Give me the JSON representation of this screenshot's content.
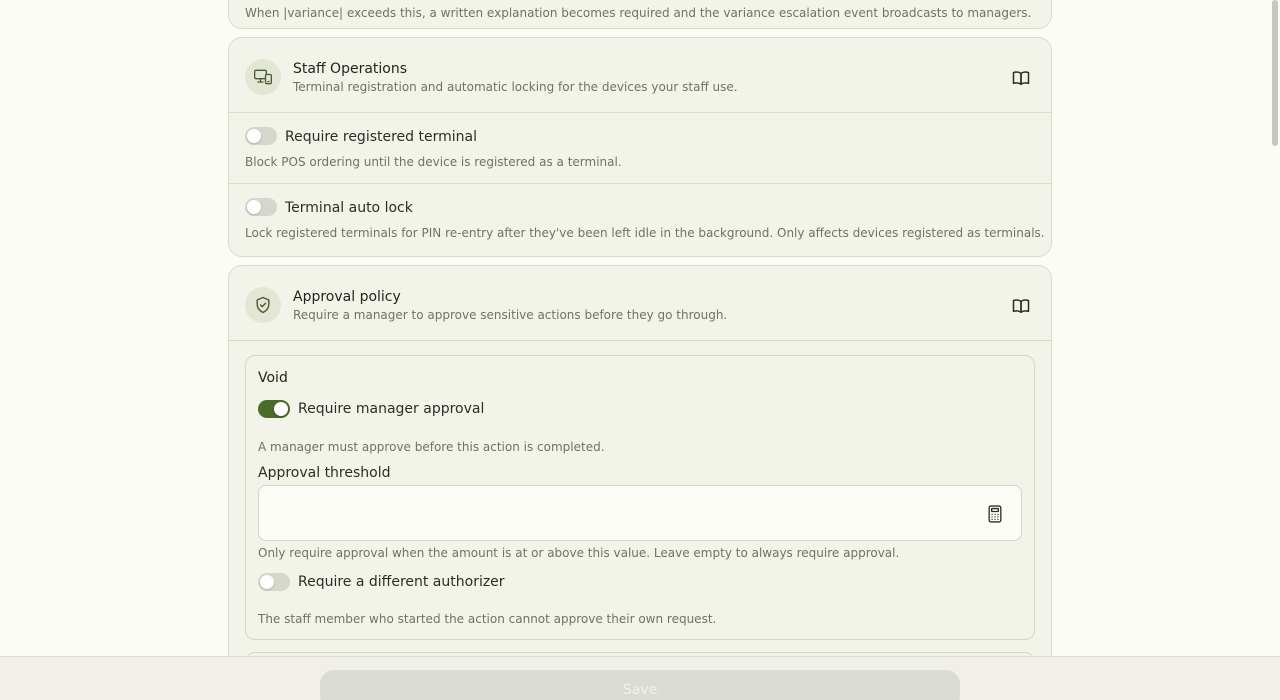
{
  "variance_card": {
    "note": "When |variance| exceeds this, a written explanation becomes required and the variance escalation event broadcasts to managers."
  },
  "staff_operations": {
    "title": "Staff Operations",
    "subtitle": "Terminal registration and automatic locking for the devices your staff use.",
    "icon": "devices-icon",
    "settings": [
      {
        "label": "Require registered terminal",
        "help": "Block POS ordering until the device is registered as a terminal.",
        "enabled": false
      },
      {
        "label": "Terminal auto lock",
        "help": "Lock registered terminals for PIN re-entry after they've been left idle in the background. Only affects devices registered as terminals.",
        "enabled": false
      }
    ]
  },
  "approval_policy": {
    "title": "Approval policy",
    "subtitle": "Require a manager to approve sensitive actions before they go through.",
    "icon": "shield-check-icon",
    "void": {
      "title": "Void",
      "require_manager_label": "Require manager approval",
      "require_manager_enabled": true,
      "require_manager_help": "A manager must approve before this action is completed.",
      "threshold_label": "Approval threshold",
      "threshold_value": "",
      "threshold_placeholder": "",
      "threshold_help": "Only require approval when the amount is at or above this value. Leave empty to always require approval.",
      "different_authorizer_label": "Require a different authorizer",
      "different_authorizer_enabled": false,
      "different_authorizer_help": "The staff member who started the action cannot approve their own request."
    }
  },
  "footer": {
    "save_label": "Save",
    "save_disabled": true
  },
  "colors": {
    "accent": "#4a6b2a",
    "card_bg": "#f3f4e9",
    "page_bg": "#fcfcf6",
    "border": "#d9dbcc"
  }
}
